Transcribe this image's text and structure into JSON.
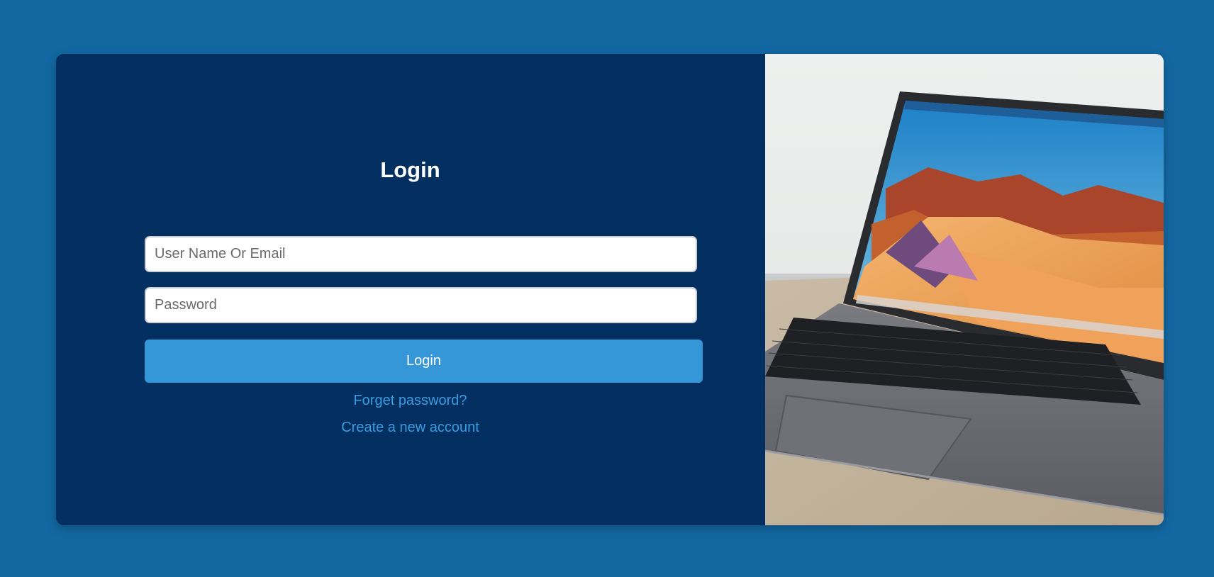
{
  "login": {
    "title": "Login",
    "username_placeholder": "User Name Or Email",
    "password_placeholder": "Password",
    "submit_label": "Login",
    "forgot_link": "Forget password?",
    "create_link": "Create a new account"
  },
  "photo": {
    "subject": "laptop on desk with desert wallpaper"
  },
  "colors": {
    "background": "#1368a2",
    "panel": "#033060",
    "button": "#3596d8",
    "link": "#3a9be0"
  }
}
